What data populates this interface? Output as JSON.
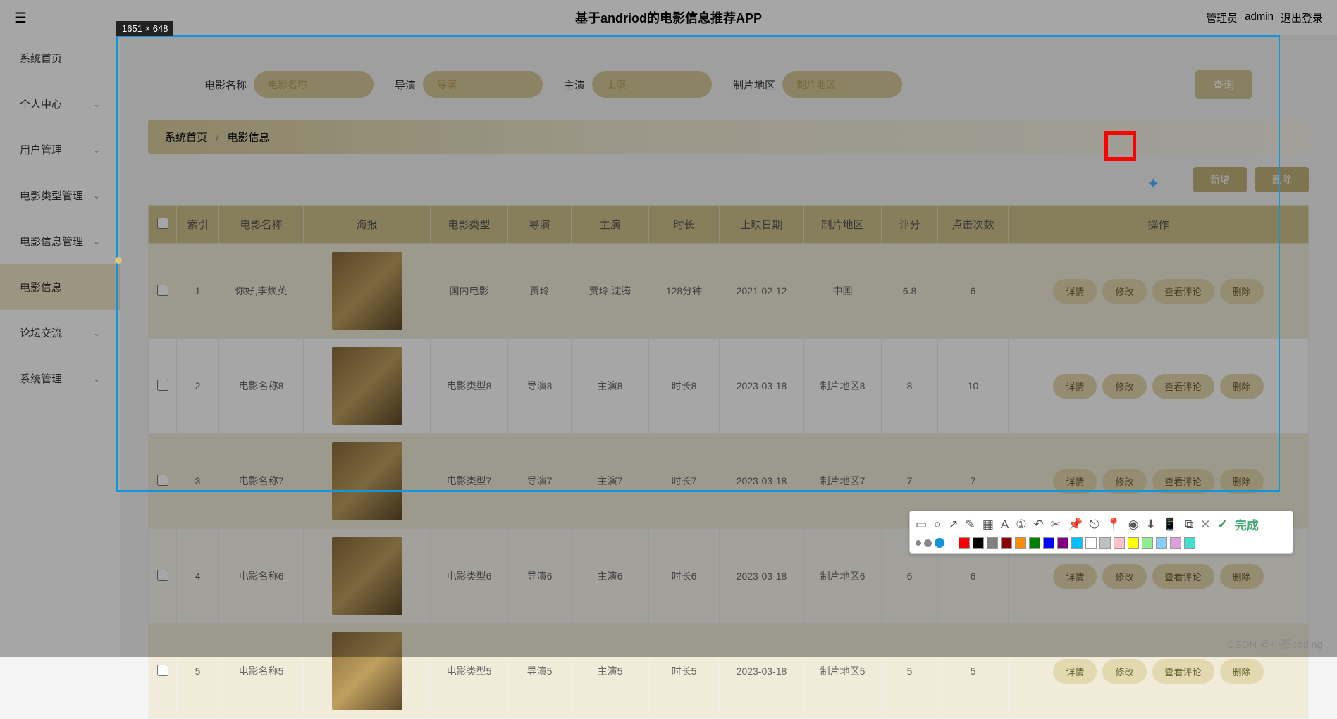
{
  "header": {
    "title": "基于andriod的电影信息推荐APP",
    "role": "管理员",
    "user": "admin",
    "logout": "退出登录"
  },
  "sidebar": {
    "items": [
      {
        "label": "系统首页",
        "expandable": false
      },
      {
        "label": "个人中心",
        "expandable": true
      },
      {
        "label": "用户管理",
        "expandable": true
      },
      {
        "label": "电影类型管理",
        "expandable": true
      },
      {
        "label": "电影信息管理",
        "expandable": true
      },
      {
        "label": "电影信息",
        "expandable": false,
        "active": true
      },
      {
        "label": "论坛交流",
        "expandable": true
      },
      {
        "label": "系统管理",
        "expandable": true
      }
    ]
  },
  "search": {
    "fields": [
      {
        "label": "电影名称",
        "placeholder": "电影名称"
      },
      {
        "label": "导演",
        "placeholder": "导演"
      },
      {
        "label": "主演",
        "placeholder": "主演"
      },
      {
        "label": "制片地区",
        "placeholder": "制片地区"
      }
    ],
    "button": "查询"
  },
  "breadcrumb": {
    "home": "系统首页",
    "sep": "/",
    "current": "电影信息"
  },
  "actions": {
    "add": "新增",
    "delete": "删除"
  },
  "table": {
    "headers": [
      "",
      "索引",
      "电影名称",
      "海报",
      "电影类型",
      "导演",
      "主演",
      "时长",
      "上映日期",
      "制片地区",
      "评分",
      "点击次数",
      "操作"
    ],
    "row_buttons": [
      "详情",
      "修改",
      "查看评论",
      "删除"
    ],
    "rows": [
      {
        "idx": "1",
        "name": "你好,李焕英",
        "type": "国内电影",
        "director": "贾玲",
        "actor": "贾玲,沈腾",
        "duration": "128分钟",
        "date": "2021-02-12",
        "region": "中国",
        "score": "6.8",
        "clicks": "6"
      },
      {
        "idx": "2",
        "name": "电影名称8",
        "type": "电影类型8",
        "director": "导演8",
        "actor": "主演8",
        "duration": "时长8",
        "date": "2023-03-18",
        "region": "制片地区8",
        "score": "8",
        "clicks": "10"
      },
      {
        "idx": "3",
        "name": "电影名称7",
        "type": "电影类型7",
        "director": "导演7",
        "actor": "主演7",
        "duration": "时长7",
        "date": "2023-03-18",
        "region": "制片地区7",
        "score": "7",
        "clicks": "7"
      },
      {
        "idx": "4",
        "name": "电影名称6",
        "type": "电影类型6",
        "director": "导演6",
        "actor": "主演6",
        "duration": "时长6",
        "date": "2023-03-18",
        "region": "制片地区6",
        "score": "6",
        "clicks": "6"
      },
      {
        "idx": "5",
        "name": "电影名称5",
        "type": "电影类型5",
        "director": "导演5",
        "actor": "主演5",
        "duration": "时长5",
        "date": "2023-03-18",
        "region": "制片地区5",
        "score": "5",
        "clicks": "5"
      }
    ]
  },
  "selection": {
    "badge": "1651 × 648"
  },
  "toolbar": {
    "icons": [
      "rect",
      "circle",
      "arrow",
      "pen",
      "mosaic",
      "text",
      "serial",
      "undo",
      "cut",
      "pin-a",
      "pin-b",
      "pin-c",
      "record",
      "download",
      "phone",
      "window",
      "close",
      "ok"
    ],
    "done": "完成",
    "colors": [
      "#ff0000",
      "#000000",
      "#808080",
      "#8b0000",
      "#ff8c00",
      "#008000",
      "#0000ff",
      "#800080",
      "#00bfff",
      "#ffffff",
      "#c0c0c0",
      "#ffc0cb",
      "#ffff00",
      "#90ee90",
      "#87cefa",
      "#dda0dd",
      "#40e0d0"
    ]
  },
  "watermark": "CSDN @小蔡coding"
}
